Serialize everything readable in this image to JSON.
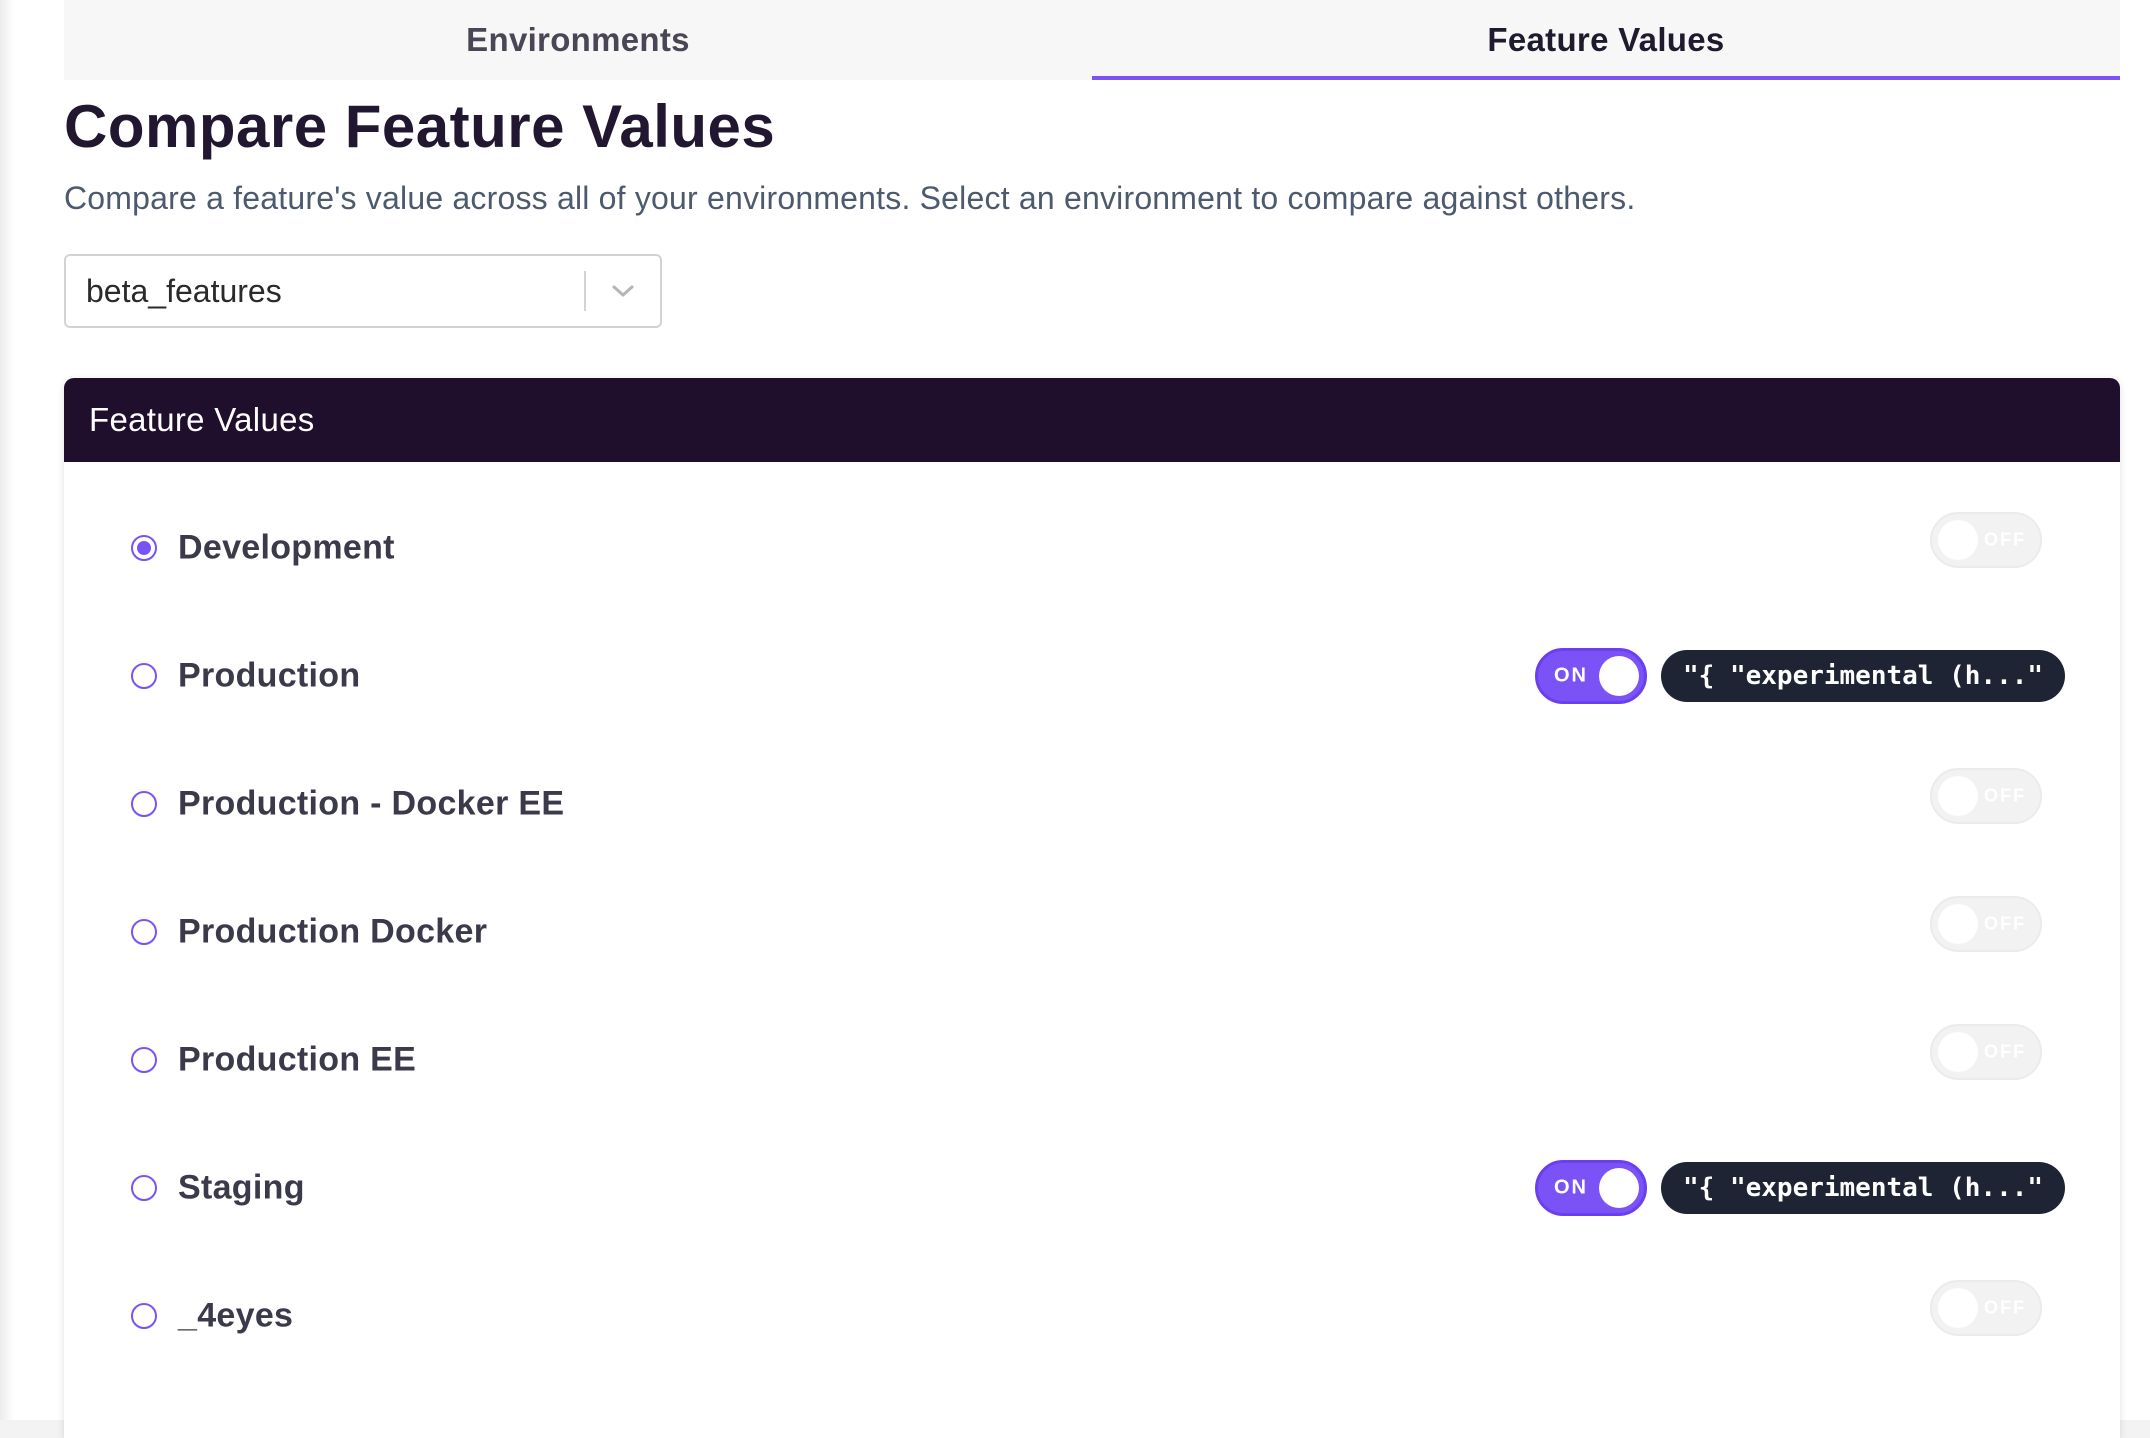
{
  "tabs": [
    {
      "label": "Environments",
      "active": false
    },
    {
      "label": "Feature Values",
      "active": true
    }
  ],
  "page": {
    "title": "Compare Feature Values",
    "subtitle": "Compare a feature's value across all of your environments. Select an environment to compare against others."
  },
  "feature_select": {
    "value": "beta_features"
  },
  "panel": {
    "title": "Feature Values"
  },
  "environments": [
    {
      "name": "Development",
      "selected": true,
      "enabled": false,
      "toggle_label": "OFF",
      "value": ""
    },
    {
      "name": "Production",
      "selected": false,
      "enabled": true,
      "toggle_label": "ON",
      "value": "\"{ \"experimental (h...\""
    },
    {
      "name": "Production - Docker EE",
      "selected": false,
      "enabled": false,
      "toggle_label": "OFF",
      "value": ""
    },
    {
      "name": "Production Docker",
      "selected": false,
      "enabled": false,
      "toggle_label": "OFF",
      "value": ""
    },
    {
      "name": "Production EE",
      "selected": false,
      "enabled": false,
      "toggle_label": "OFF",
      "value": ""
    },
    {
      "name": "Staging",
      "selected": false,
      "enabled": true,
      "toggle_label": "ON",
      "value": "\"{ \"experimental (h...\""
    },
    {
      "name": "_4eyes",
      "selected": false,
      "enabled": false,
      "toggle_label": "OFF",
      "value": ""
    }
  ],
  "colors": {
    "accent": "#7b52f5",
    "header_bg": "#1f0f2c",
    "pill_bg": "#1e2433"
  },
  "icons": {
    "select_chevron": "chevron-down-icon"
  }
}
